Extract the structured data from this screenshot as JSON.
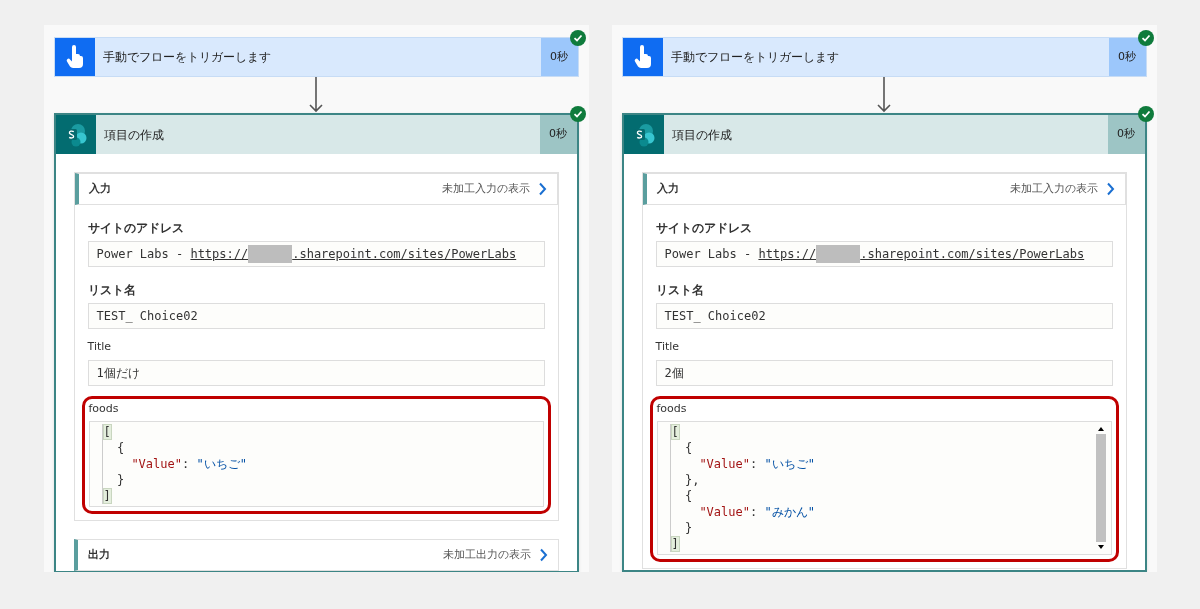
{
  "panels": [
    {
      "trigger": {
        "title": "手動でフローをトリガーします",
        "duration": "0秒",
        "succeeded": true
      },
      "action": {
        "title": "項目の作成",
        "duration": "0秒",
        "succeeded": true,
        "inputs": {
          "heading": "入力",
          "link": "未加工入力の表示"
        },
        "fields": [
          {
            "kind": "address",
            "label": "サイトのアドレス",
            "bold": true,
            "prefix": "Power Labs - ",
            "link_start": "https://",
            "link_end": ".sharepoint.com/sites/PowerLabs",
            "redacted": true
          },
          {
            "kind": "text",
            "label": "リスト名",
            "bold": true,
            "value": "TEST_ Choice02"
          },
          {
            "kind": "text",
            "label": "Title",
            "bold": false,
            "value": "1個だけ"
          },
          {
            "kind": "code",
            "label": "foods",
            "bold": false,
            "highlighted": true,
            "scrollbar": false,
            "lines": [
              [
                {
                  "kind": "bracket",
                  "text": "["
                }
              ],
              [
                {
                  "kind": "punct",
                  "text": "  {"
                }
              ],
              [
                {
                  "kind": "key",
                  "text": "    \"Value\""
                },
                {
                  "kind": "punct",
                  "text": ": "
                },
                {
                  "kind": "string",
                  "text": "\"いちご\""
                }
              ],
              [
                {
                  "kind": "punct",
                  "text": "  }"
                }
              ],
              [
                {
                  "kind": "bracket",
                  "text": "]"
                }
              ]
            ]
          }
        ],
        "outputs": {
          "heading": "出力",
          "link": "未加工出力の表示"
        }
      }
    },
    {
      "trigger": {
        "title": "手動でフローをトリガーします",
        "duration": "0秒",
        "succeeded": true
      },
      "action": {
        "title": "項目の作成",
        "duration": "0秒",
        "succeeded": true,
        "inputs": {
          "heading": "入力",
          "link": "未加工入力の表示"
        },
        "fields": [
          {
            "kind": "address",
            "label": "サイトのアドレス",
            "bold": true,
            "prefix": "Power Labs - ",
            "link_start": "https://",
            "link_end": ".sharepoint.com/sites/PowerLabs",
            "redacted": true
          },
          {
            "kind": "text",
            "label": "リスト名",
            "bold": true,
            "value": "TEST_ Choice02"
          },
          {
            "kind": "text",
            "label": "Title",
            "bold": false,
            "value": "2個"
          },
          {
            "kind": "code",
            "label": "foods",
            "bold": false,
            "highlighted": true,
            "scrollbar": true,
            "lines": [
              [
                {
                  "kind": "bracket",
                  "text": "["
                }
              ],
              [
                {
                  "kind": "punct",
                  "text": "  {"
                }
              ],
              [
                {
                  "kind": "key",
                  "text": "    \"Value\""
                },
                {
                  "kind": "punct",
                  "text": ": "
                },
                {
                  "kind": "string",
                  "text": "\"いちご\""
                }
              ],
              [
                {
                  "kind": "punct",
                  "text": "  },"
                }
              ],
              [
                {
                  "kind": "punct",
                  "text": "  {"
                }
              ],
              [
                {
                  "kind": "key",
                  "text": "    \"Value\""
                },
                {
                  "kind": "punct",
                  "text": ": "
                },
                {
                  "kind": "string",
                  "text": "\"みかん\""
                }
              ],
              [
                {
                  "kind": "punct",
                  "text": "  }"
                }
              ],
              [
                {
                  "kind": "bracket",
                  "text": "]"
                }
              ]
            ]
          }
        ]
      }
    }
  ]
}
